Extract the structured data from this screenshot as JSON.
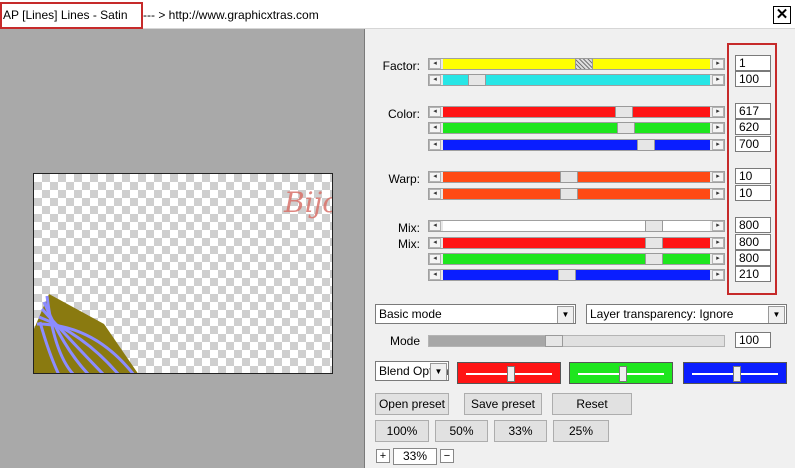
{
  "window": {
    "title": "AP [Lines]  Lines - Satin",
    "subtitle": "--- > http://www.graphicxtras.com",
    "close_glyph": "✕"
  },
  "preview": {
    "watermark": "Bijoune"
  },
  "labels": {
    "factor": "Factor:",
    "color": "Color:",
    "warp": "Warp:",
    "mix1": "Mix:",
    "mix2": "Mix:",
    "mode": "Mode"
  },
  "sliders": [
    {
      "id": "factor-1",
      "color": "#ffff00",
      "value": "1",
      "pos": 0.53,
      "thumb": "checked"
    },
    {
      "id": "factor-2",
      "color": "#27e6e6",
      "value": "100",
      "pos": 0.1
    },
    {
      "id": "color-red",
      "color": "#ff1414",
      "value": "617",
      "pos": 0.69
    },
    {
      "id": "color-green",
      "color": "#1ee61e",
      "value": "620",
      "pos": 0.7
    },
    {
      "id": "color-blue",
      "color": "#0a1eff",
      "value": "700",
      "pos": 0.78
    },
    {
      "id": "warp-1",
      "color": "#ff4a14",
      "value": "10",
      "pos": 0.47
    },
    {
      "id": "warp-2",
      "color": "#ff4a14",
      "value": "10",
      "pos": 0.47
    },
    {
      "id": "mix-white",
      "color": "#ffffff",
      "value": "800",
      "pos": 0.81
    },
    {
      "id": "mix-red",
      "color": "#ff1414",
      "value": "800",
      "pos": 0.81
    },
    {
      "id": "mix-green",
      "color": "#1ee61e",
      "value": "800",
      "pos": 0.81
    },
    {
      "id": "mix-blue",
      "color": "#0a1eff",
      "value": "210",
      "pos": 0.46
    }
  ],
  "mode_select": "Basic mode",
  "layer_select": "Layer transparency: Ignore",
  "mode_slider": {
    "value": "100",
    "pos": 0.42
  },
  "blend_select": "Blend Options",
  "blend_boxes": [
    {
      "color": "#ff1414",
      "pos": 0.5
    },
    {
      "color": "#1ee61e",
      "pos": 0.5
    },
    {
      "color": "#0a1eff",
      "pos": 0.5
    }
  ],
  "buttons": {
    "open_preset": "Open preset",
    "save_preset": "Save preset",
    "reset": "Reset",
    "zoom_100": "100%",
    "zoom_50": "50%",
    "zoom_33": "33%",
    "zoom_25": "25%"
  },
  "zoom": {
    "plus": "+",
    "minus": "−",
    "value": "33%"
  }
}
